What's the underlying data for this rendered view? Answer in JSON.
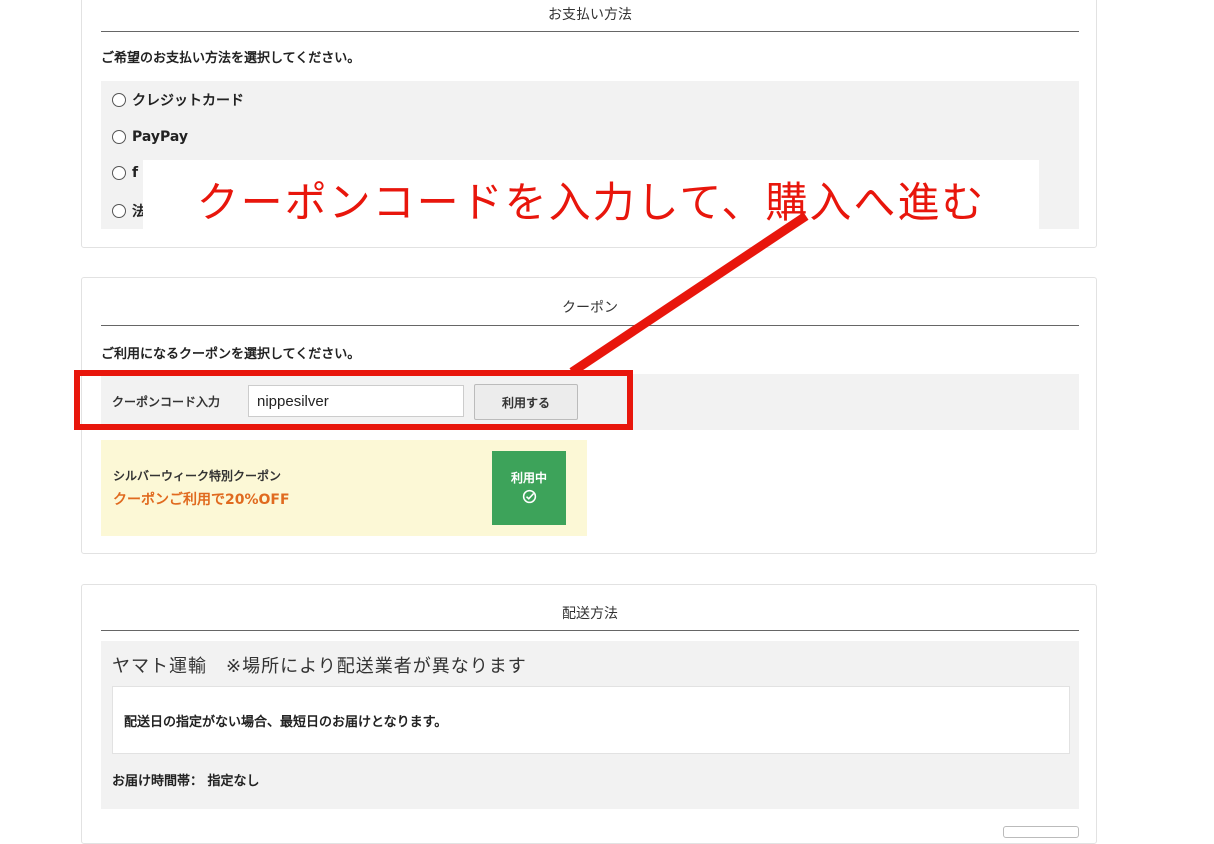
{
  "payment": {
    "title": "お支払い方法",
    "instruction": "ご希望のお支払い方法を選択してください。",
    "options": [
      {
        "label": "クレジットカード"
      },
      {
        "label": "PayPay"
      },
      {
        "label": "f"
      },
      {
        "label": "法"
      }
    ]
  },
  "annotation": {
    "text": "クーポンコードを入力して、購入へ進む",
    "color": "#e8160c"
  },
  "coupon": {
    "title": "クーポン",
    "instruction": "ご利用になるクーポンを選択してください。",
    "code_label": "クーポンコード入力",
    "code_value": "nippesilver",
    "apply_label": "利用する",
    "card": {
      "name": "シルバーウィーク特別クーポン",
      "discount": "クーポンご利用で20%OFF",
      "status": "利用中",
      "status_color": "#3da35a"
    }
  },
  "shipping": {
    "title": "配送方法",
    "method": "ヤマト運輸　※場所により配送業者が異なります",
    "note": "配送日の指定がない場合、最短日のお届けとなります。",
    "time_label": "お届け時間帯：",
    "time_value": "指定なし"
  }
}
